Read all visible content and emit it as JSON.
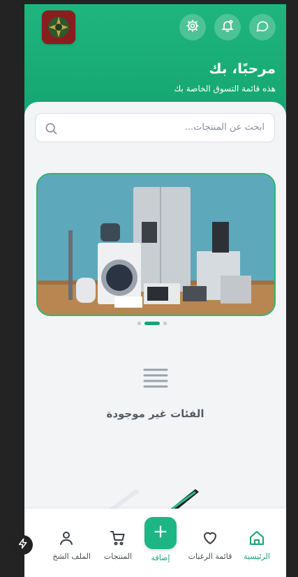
{
  "header": {
    "welcome": "مرحبًا، بك",
    "subtitle": "هذه قائمة التسوق الخاصة بك"
  },
  "icons": {
    "chat": "chat-icon",
    "notifications": "bell-icon",
    "settings": "gear-icon"
  },
  "search": {
    "placeholder": "ابحث عن المنتجات..."
  },
  "carousel": {
    "slides": 3,
    "active_index": 1
  },
  "categories": {
    "empty_message": "الفئات غير موجودة"
  },
  "bottom_nav": {
    "home": "الرئيسية",
    "wishlist": "قائمة الرغبات",
    "add": "إضافة",
    "products": "المنتجات",
    "profile": "الملف الشخ"
  },
  "colors": {
    "brand": "#15a571",
    "background": "#f3f4f6"
  }
}
